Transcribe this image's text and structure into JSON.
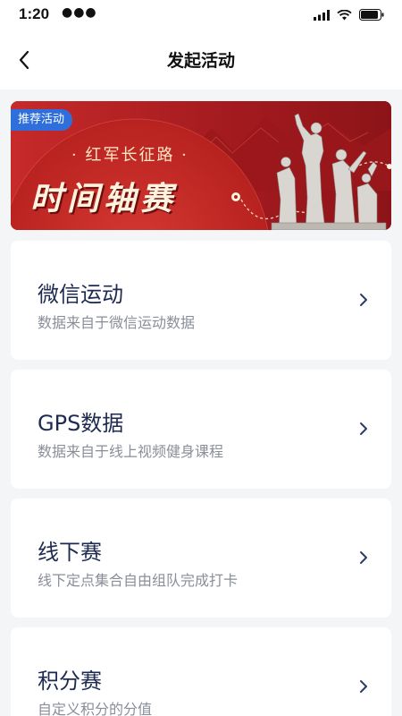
{
  "status_bar": {
    "time": "1:20",
    "dots": "●●●",
    "icons": [
      "signal-icon",
      "wifi-icon",
      "battery-icon"
    ]
  },
  "nav": {
    "title": "发起活动",
    "back_icon": "chevron-left-icon"
  },
  "banner": {
    "tag": "推荐活动",
    "subtitle": "· 红军长征路 ·",
    "title": "时间轴赛",
    "colors": {
      "background": "#b01f22",
      "tag": "#2f6fdc",
      "text": "#fff3de"
    }
  },
  "options": [
    {
      "title": "微信运动",
      "description": "数据来自于微信运动数据"
    },
    {
      "title": "GPS数据",
      "description": "数据来自于线上视频健身课程"
    },
    {
      "title": "线下赛",
      "description": "线下定点集合自由组队完成打卡"
    },
    {
      "title": "积分赛",
      "description": "自定义积分的分值"
    }
  ],
  "theme": {
    "title_color": "#1e2a50",
    "chevron_color": "#2b3d66",
    "page_background": "#f4f5f7"
  }
}
